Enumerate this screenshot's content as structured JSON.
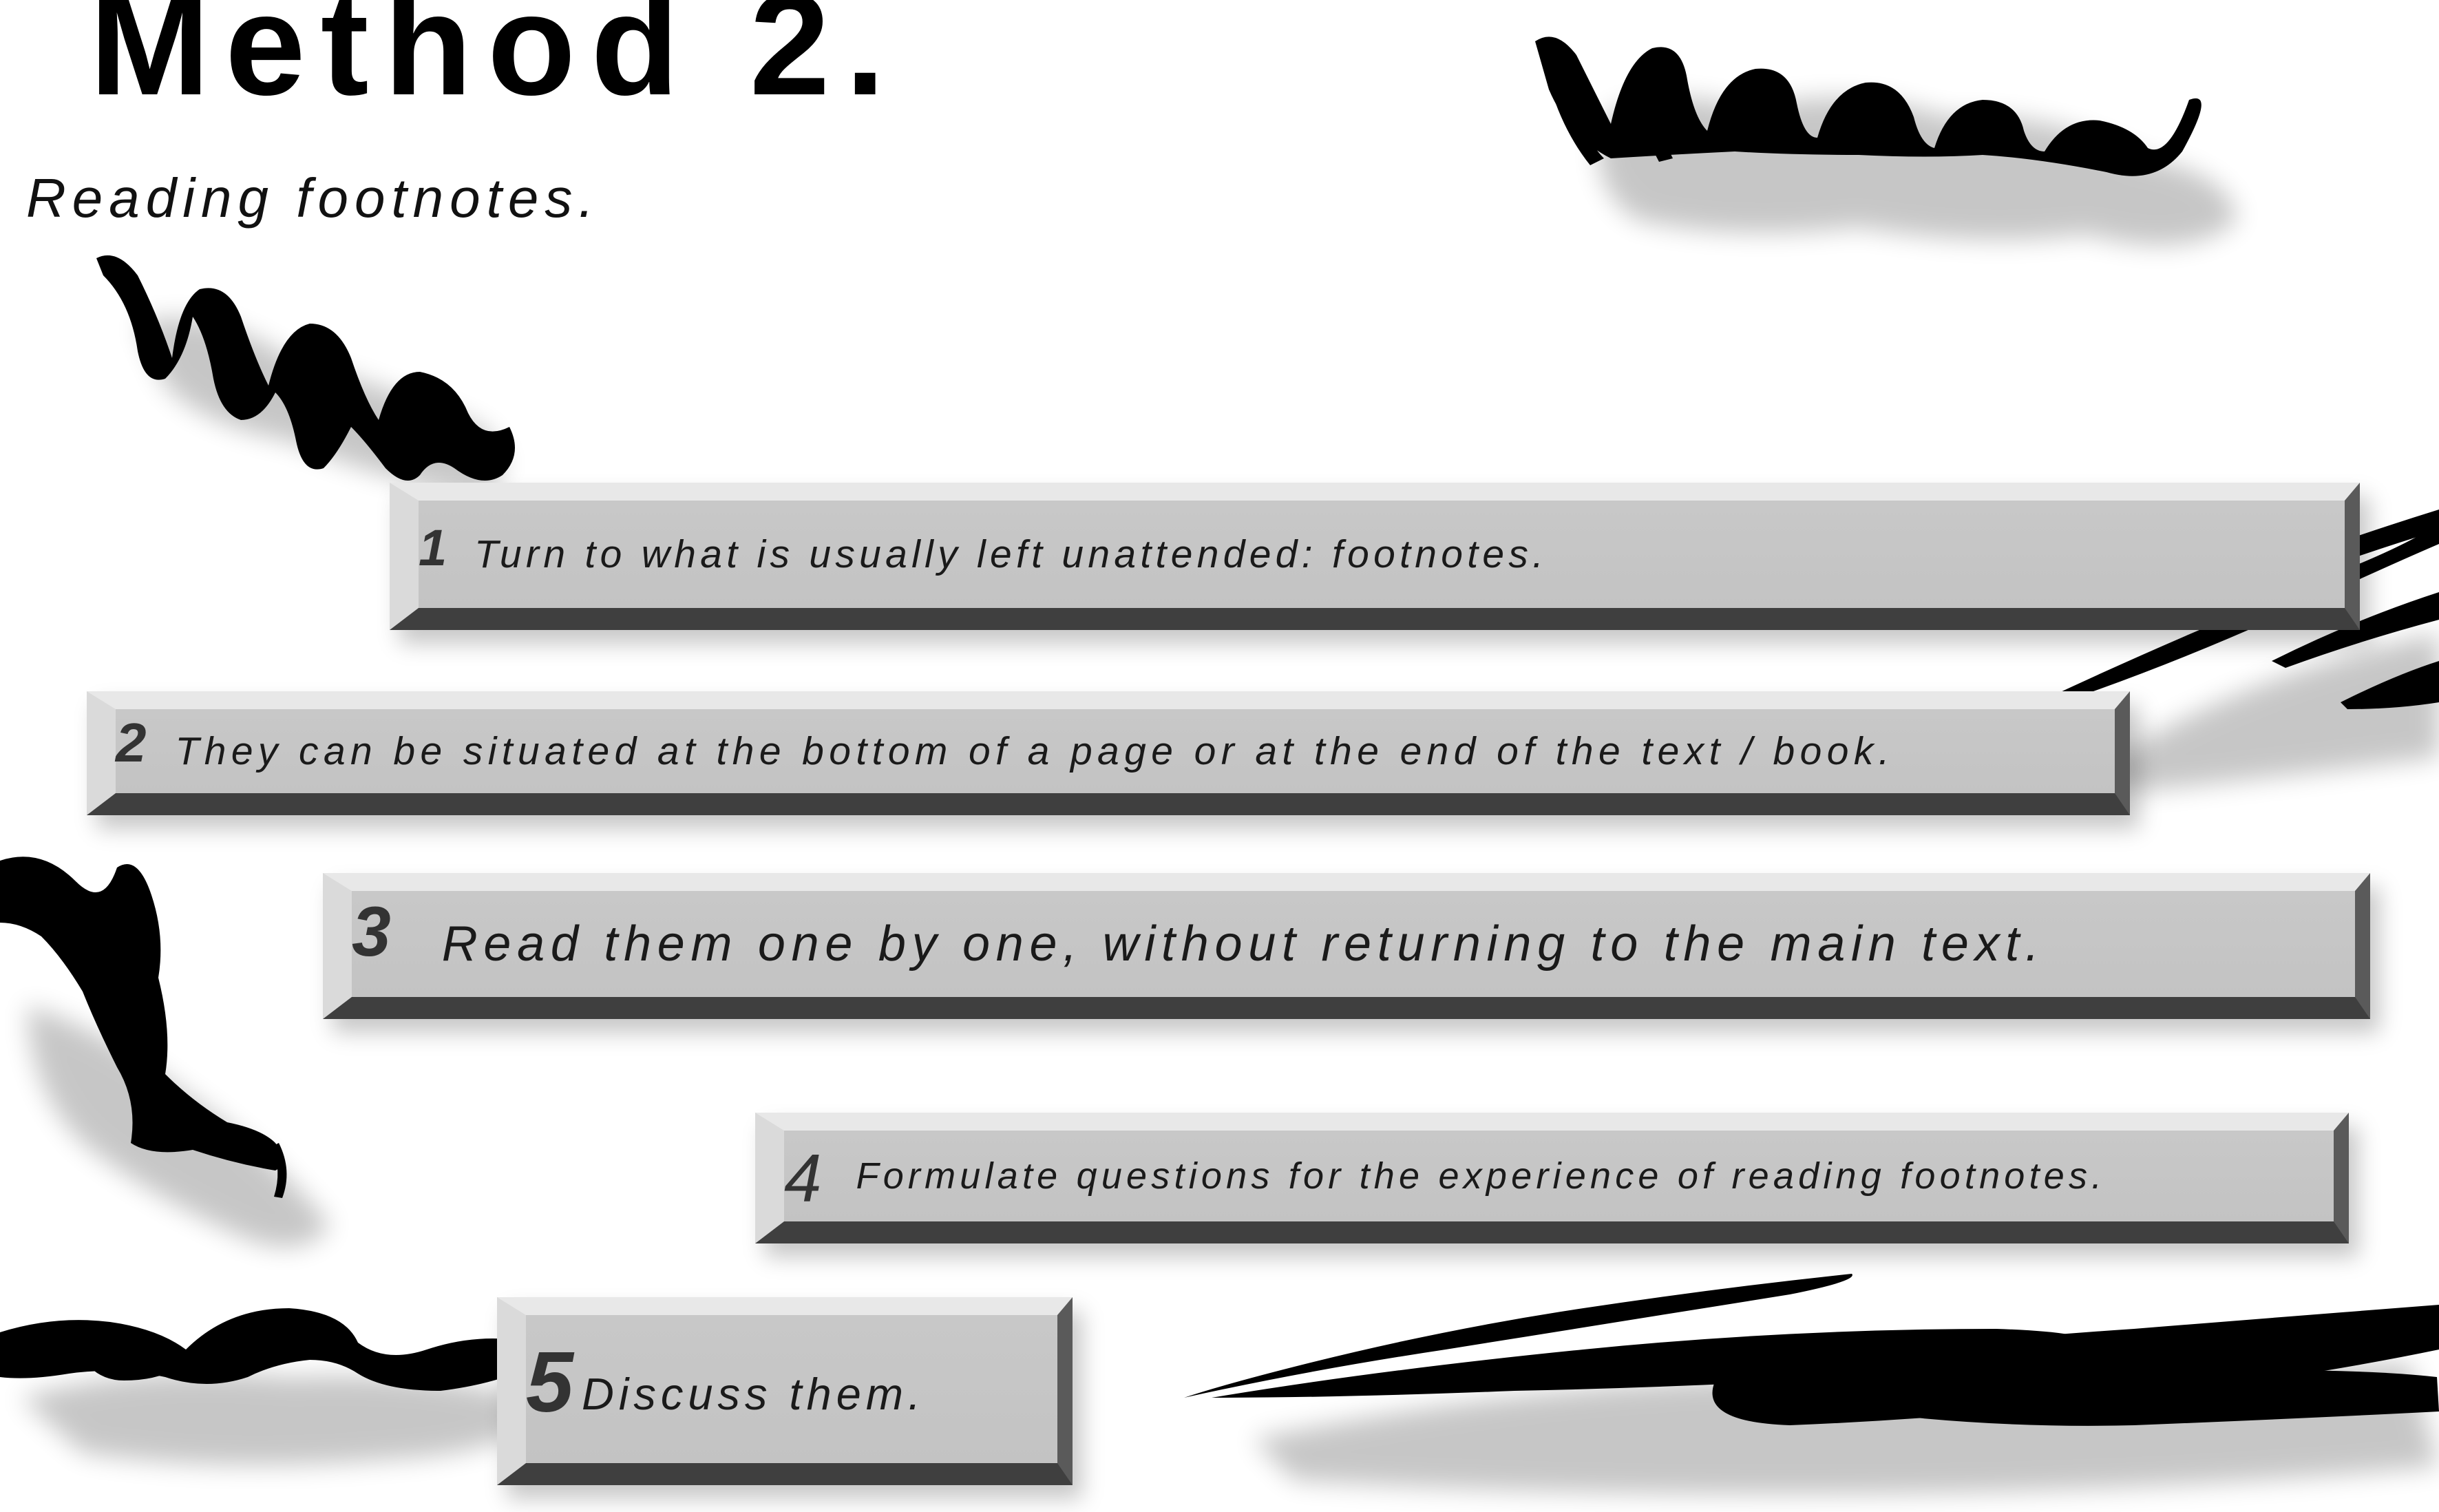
{
  "slide": {
    "title": "Method 2.",
    "subtitle": "Reading footnotes.",
    "steps": [
      {
        "number": "1",
        "text": "Turn to what is usually left unattended: footnotes."
      },
      {
        "number": "2",
        "text": "They can be situated at the bottom of a page or at the end of the text / book."
      },
      {
        "number": "3",
        "text": "Read them one by one, without returning to the main text."
      },
      {
        "number": "4",
        "text": "Formulate questions for the experience of reading footnotes."
      },
      {
        "number": "5",
        "text": "Discuss them."
      }
    ]
  },
  "colors": {
    "background": "#ffffff",
    "bar_face": "#c6c6c6",
    "bar_highlight": "#e8e8e8",
    "bar_shadow": "#3f3f3f",
    "ink": "#000000"
  }
}
